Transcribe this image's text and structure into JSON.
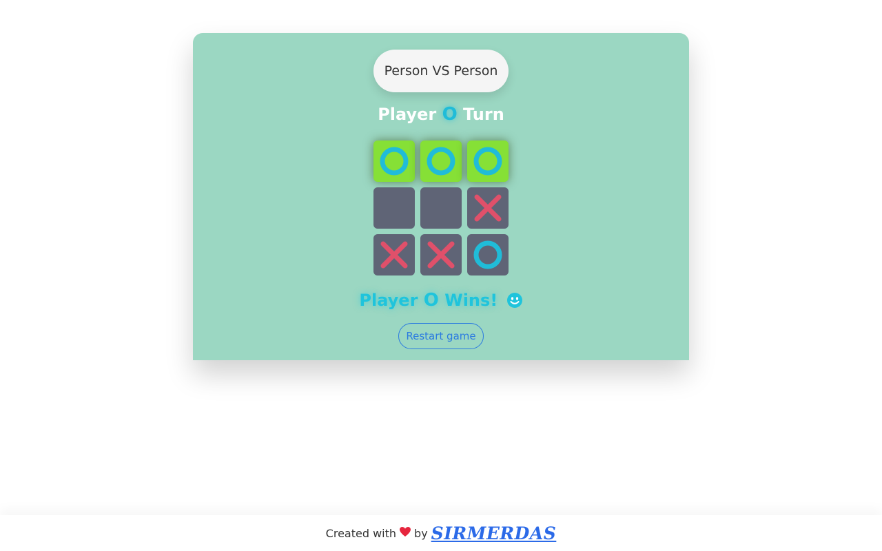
{
  "header": {
    "mode_label": "Person VS Person"
  },
  "status": {
    "turn_prefix": "Player",
    "turn_mark": "O",
    "turn_suffix": "Turn"
  },
  "board": {
    "cells": [
      "O",
      "O",
      "O",
      "",
      "",
      "X",
      "X",
      "X",
      "O"
    ],
    "winning_cells": [
      true,
      true,
      true,
      false,
      false,
      false,
      false,
      false,
      false
    ]
  },
  "result": {
    "prefix": "Player",
    "mark": "O",
    "suffix": "Wins!",
    "icon": "smiley-icon"
  },
  "controls": {
    "restart_label": "Restart game"
  },
  "footer": {
    "created_text": "Created with",
    "heart_icon": "heart-icon",
    "by_text": "by",
    "author": "SIRMERDAS"
  },
  "colors": {
    "card_bg": "#9bd7c2",
    "cell_bg": "#5f6476",
    "win_cell_bg": "#86e036",
    "o_color": "#20bcd8",
    "x_color": "#e0506a",
    "link_color": "#2b6ae8"
  }
}
